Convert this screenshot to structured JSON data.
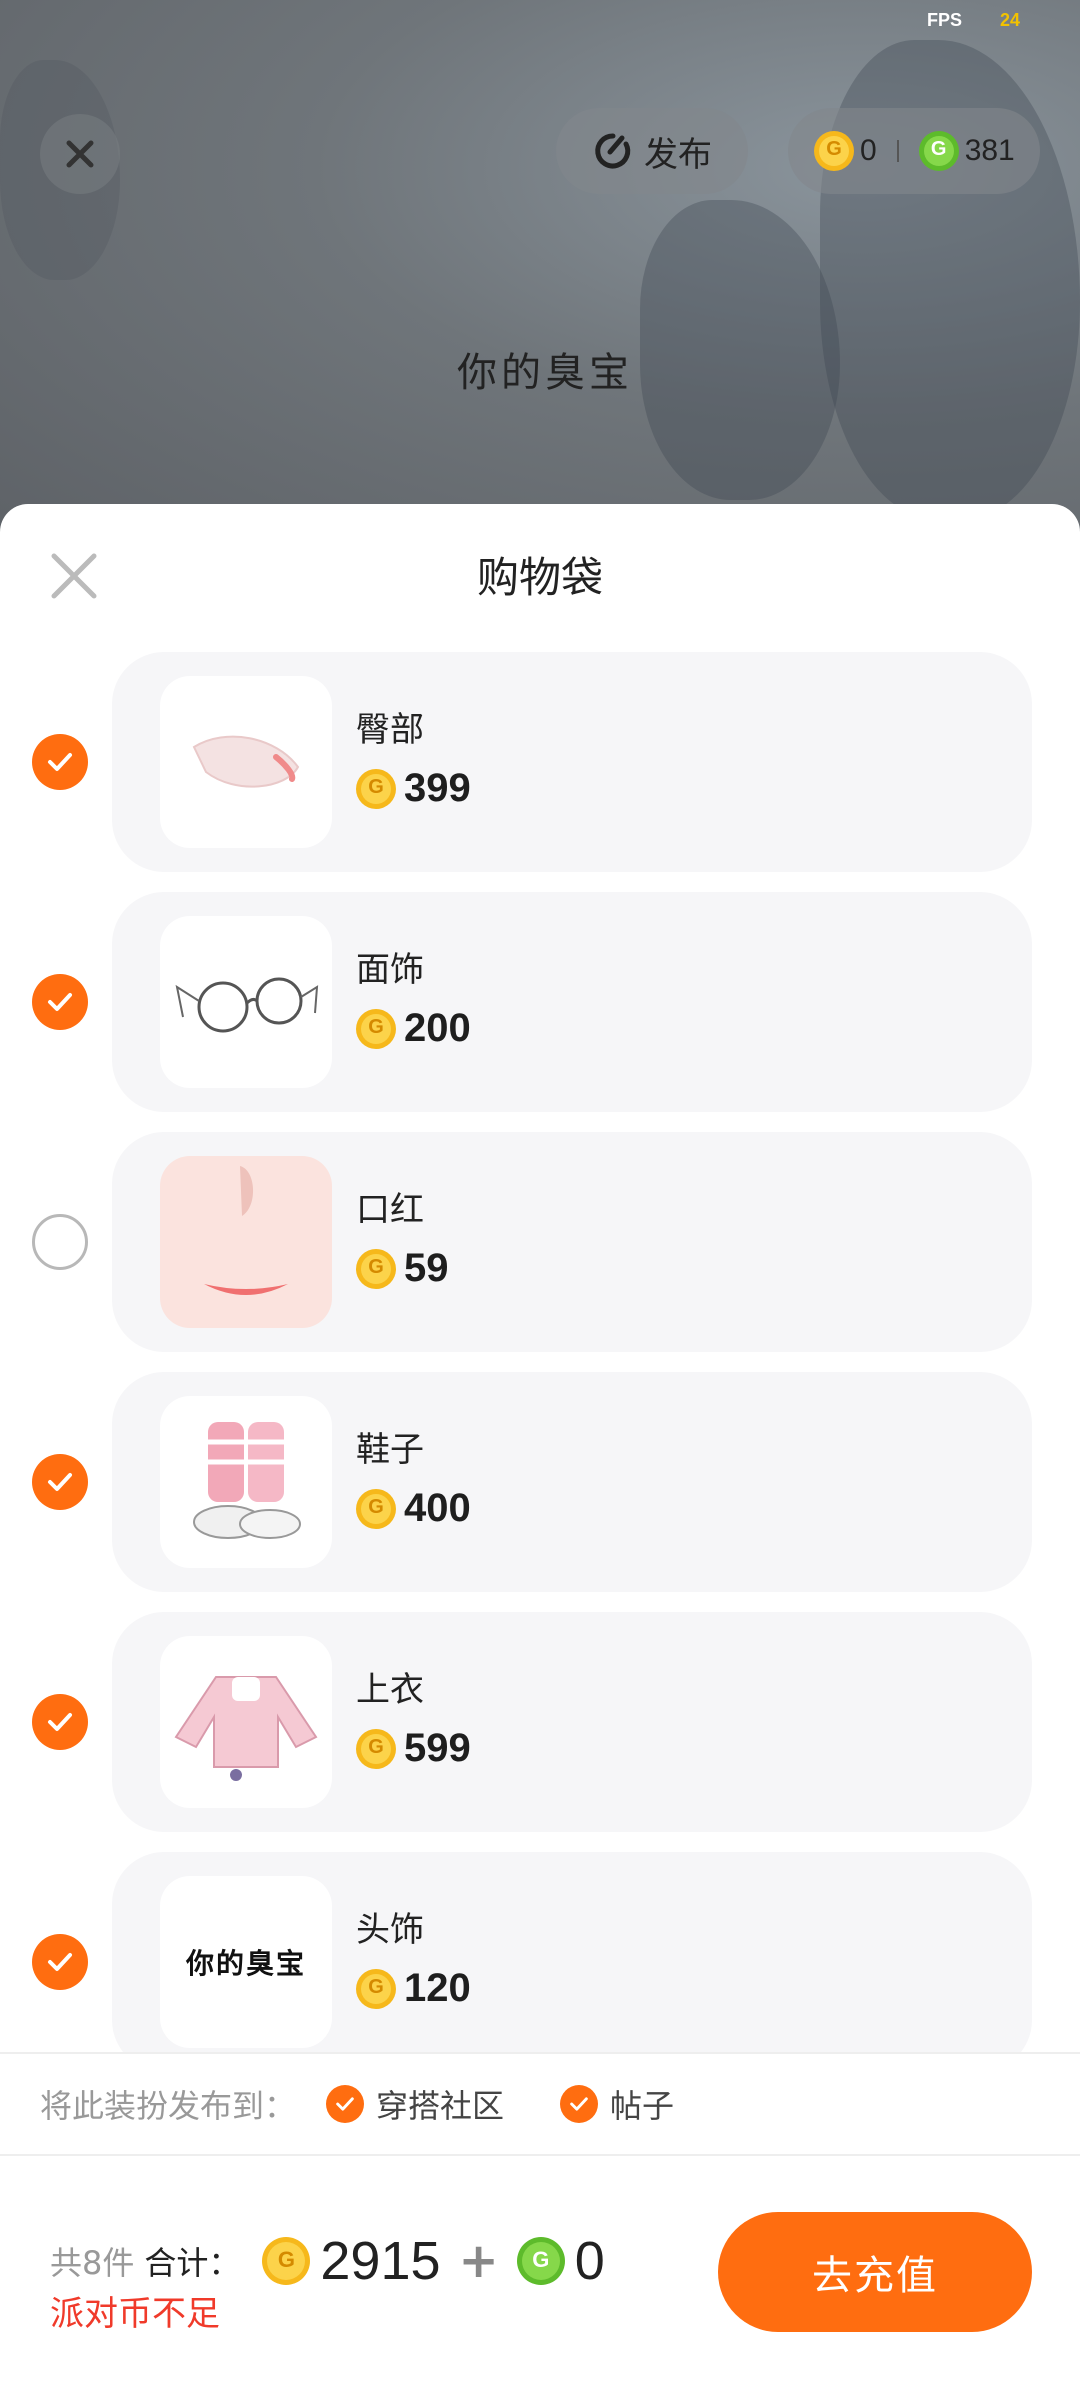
{
  "status": {
    "fps_label": "FPS",
    "fps_value": "24"
  },
  "scene": {
    "publish_label": "发布",
    "gold_balance": "0",
    "green_balance": "381",
    "title_text": "你的臭宝"
  },
  "sheet": {
    "title": "购物袋",
    "items": [
      {
        "name": "臀部",
        "price": "399",
        "checked": true
      },
      {
        "name": "面饰",
        "price": "200",
        "checked": true
      },
      {
        "name": "口红",
        "price": "59",
        "checked": false
      },
      {
        "name": "鞋子",
        "price": "400",
        "checked": true
      },
      {
        "name": "上衣",
        "price": "599",
        "checked": true
      },
      {
        "name": "头饰",
        "price": "120",
        "checked": true,
        "thumb_text": "你的臭宝"
      }
    ],
    "publish_to_label": "将此装扮发布到：",
    "publish_options": [
      "穿搭社区",
      "帖子"
    ]
  },
  "footer": {
    "count_text": "共8件",
    "total_label": "合计：",
    "gold_total": "2915",
    "plus": "+",
    "green_total": "0",
    "warning": "派对币不足",
    "recharge_label": "去充值"
  },
  "colors": {
    "accent": "#ff6d10",
    "warning": "#f03a2a",
    "gold": "#f6b81b",
    "green": "#5dbb2b"
  }
}
